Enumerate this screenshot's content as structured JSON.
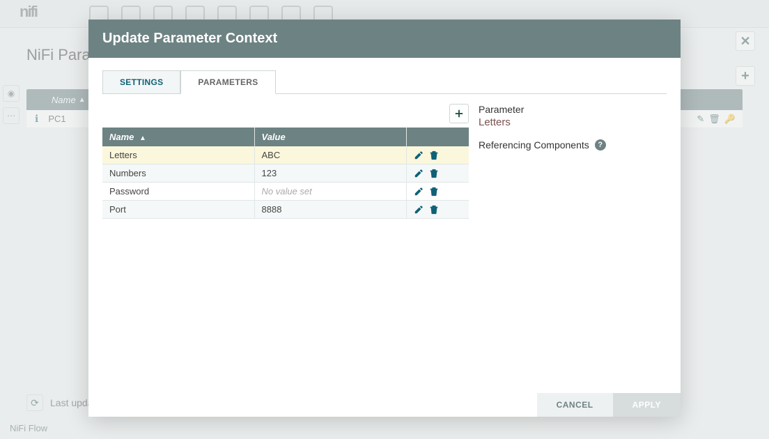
{
  "bg": {
    "title": "NiFi Param",
    "list_header": "Name",
    "row_name": "PC1",
    "footer_text": "Last upda",
    "breadcrumb": "NiFi Flow"
  },
  "modal": {
    "title": "Update Parameter Context",
    "tabs": {
      "settings": "SETTINGS",
      "parameters": "PARAMETERS"
    },
    "columns": {
      "name": "Name",
      "value": "Value"
    },
    "rows": [
      {
        "name": "Letters",
        "value": "ABC",
        "selected": true,
        "no_value": false
      },
      {
        "name": "Numbers",
        "value": "123",
        "selected": false,
        "no_value": false
      },
      {
        "name": "Password",
        "value": "No value set",
        "selected": false,
        "no_value": true
      },
      {
        "name": "Port",
        "value": "8888",
        "selected": false,
        "no_value": false
      }
    ],
    "detail": {
      "param_label": "Parameter",
      "param_name": "Letters",
      "ref_label": "Referencing Components"
    },
    "buttons": {
      "cancel": "CANCEL",
      "apply": "APPLY"
    }
  }
}
